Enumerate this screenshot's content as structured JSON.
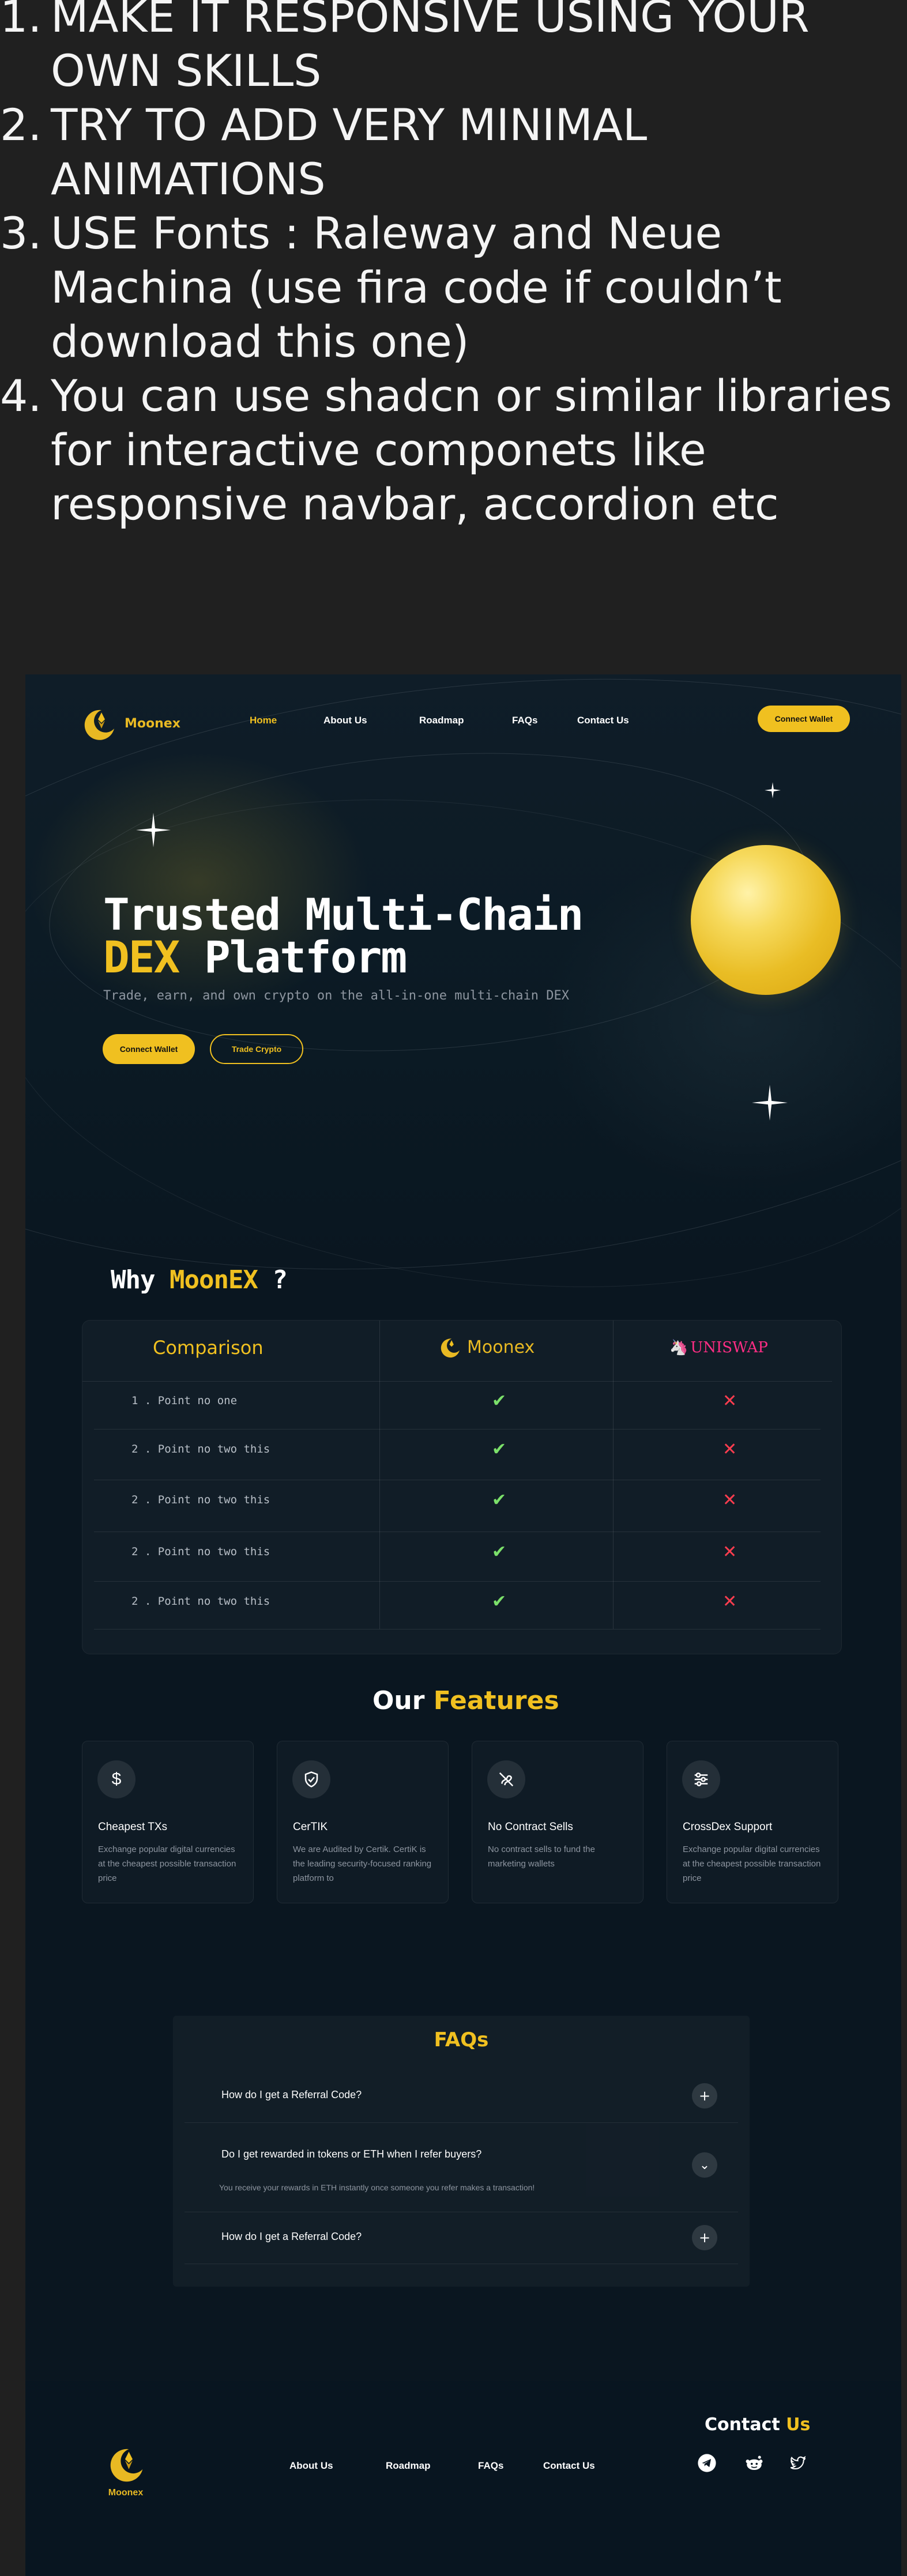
{
  "instructions": [
    {
      "num": "1.",
      "text": "MAKE IT RESPONSIVE USING YOUR OWN SKILLS"
    },
    {
      "num": "2.",
      "text": "TRY TO ADD VERY MINIMAL ANIMATIONS"
    },
    {
      "num": "3.",
      "text": "USE Fonts : Raleway and Neue Machina (use fira code if couldn’t download this one)"
    },
    {
      "num": "4.",
      "text": "You can use shadcn  or similar libraries for interactive componets like responsive navbar, accordion etc"
    }
  ],
  "nav": {
    "brand": "Moonex",
    "links": [
      "Home",
      "About Us",
      "Roadmap",
      "FAQs",
      "Contact Us"
    ],
    "active": "Home",
    "cta": "Connect Wallet"
  },
  "hero": {
    "title_line1": "Trusted Multi-Chain",
    "title_highlight": "DEX",
    "title_line2_rest": " Platform",
    "subtitle": "Trade, earn, and own crypto on the all-in-one multi-chain DEX",
    "primary_button": "Connect Wallet",
    "secondary_button": "Trade Crypto"
  },
  "why": {
    "title_prefix": "Why ",
    "title_highlight": "MoonEX",
    "title_suffix": " ?"
  },
  "comparison": {
    "header": "Comparison",
    "brand_a": "Moonex",
    "brand_b": "UNISWAP",
    "rows": [
      {
        "label": "1 . Point no one",
        "a": "✔",
        "b": "✕"
      },
      {
        "label": "2 . Point no two this",
        "a": "✔",
        "b": "✕"
      },
      {
        "label": "2 . Point no two this",
        "a": "✔",
        "b": "✕"
      },
      {
        "label": "2 . Point no two this",
        "a": "✔",
        "b": "✕"
      },
      {
        "label": "2 . Point no two this",
        "a": "✔",
        "b": "✕"
      }
    ]
  },
  "features": {
    "title_prefix": "Our ",
    "title_highlight": "Features",
    "items": [
      {
        "icon": "dollar-icon",
        "title": "Cheapest TXs",
        "desc": "Exchange popular digital currencies at the cheapest possible transaction price"
      },
      {
        "icon": "shield-check-icon",
        "title": "CerTIK",
        "desc": "We are Audited by Certik. CertiK is the leading security-focused ranking platform to"
      },
      {
        "icon": "no-contract-icon",
        "title": "No Contract Sells",
        "desc": "No contract sells to fund the marketing wallets"
      },
      {
        "icon": "sliders-icon",
        "title": "CrossDex Support",
        "desc": "Exchange popular digital currencies at the cheapest possible transaction price"
      }
    ]
  },
  "faq": {
    "title": "FAQs",
    "items": [
      {
        "q": "How do I get a Referral Code?",
        "a": "",
        "state": "+"
      },
      {
        "q": "Do I get rewarded in tokens or ETH when I refer buyers?",
        "a": "You receive your rewards in ETH instantly once someone you refer makes a transaction!",
        "state": "⌄"
      },
      {
        "q": "How do I get a Referral Code?",
        "a": "",
        "state": "+"
      }
    ]
  },
  "footer": {
    "brand": "Moonex",
    "links": [
      "About Us",
      "Roadmap",
      "FAQs",
      "Contact Us"
    ],
    "contact_prefix": "Contact ",
    "contact_highlight": "Us",
    "socials": [
      "telegram-icon",
      "reddit-icon",
      "twitter-icon"
    ]
  },
  "colors": {
    "accent": "#f0c020",
    "bg": "#0a1620",
    "outer": "#202020",
    "tick": "#7be06a",
    "cross": "#ff3d4f"
  }
}
